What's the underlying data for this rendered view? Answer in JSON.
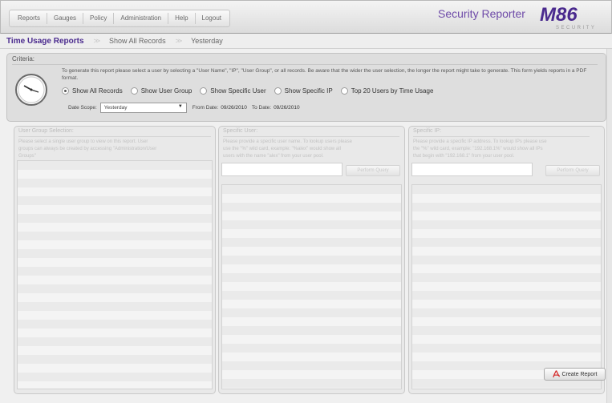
{
  "menu": {
    "items": [
      "Reports",
      "Gauges",
      "Policy",
      "Administration",
      "Help",
      "Logout"
    ]
  },
  "app": {
    "title": "Security Reporter",
    "logo_text": "M86",
    "logo_subtext": "SECURITY"
  },
  "breadcrumb": [
    "Time Usage Reports",
    "Show All Records",
    "Yesterday"
  ],
  "criteria": {
    "title": "Criteria:",
    "description": "To generate this report please select a user by selecting a \"User Name\", \"IP\", \"User Group\", or all records. Be aware that the wider the user selection, the longer the report might take to generate. This form yields reports in a PDF format.",
    "options": [
      "Show All Records",
      "Show User Group",
      "Show Specific User",
      "Show Specific IP",
      "Top 20 Users by Time Usage"
    ],
    "selected_option": "Show All Records",
    "date_scope_label": "Date Scope:",
    "date_scope_value": "Yesterday",
    "from_label": "From Date:",
    "from_value": "09/26/2010",
    "to_label": "To Date:",
    "to_value": "09/26/2010"
  },
  "panels": {
    "group": {
      "title": "User Group Selection:",
      "description_line1": "Please select a single user group to view on this report. User",
      "description_line2": "groups can always be created by accessing \"Administration/User",
      "description_line3": "Groups\""
    },
    "user": {
      "title": "Specific User:",
      "description_line1": "Please provide a specific user name. To lookup users please",
      "description_line2": "use the \"%\" wild card, example: \"%alex\" would show all",
      "description_line3": "users with the name \"alex\" from your user pool.",
      "button_label": "Perform Query"
    },
    "ip": {
      "title": "Specific IP:",
      "description_line1": "Please provide a specific IP address. To lookup IPs please use",
      "description_line2": "the \"%\" wild card, example: \"192.168.1%\" would show all IPs",
      "description_line3": "that begin with \"192.168.1\" from your user pool.",
      "button_label": "Perform Query"
    }
  },
  "actions": {
    "create_report_label": "Create Report"
  },
  "colors": {
    "brand_purple": "#6e4aa8",
    "breadcrumb_active": "#4a2a8e"
  },
  "icons": {
    "clock": "clock-icon",
    "pdf": "pdf-icon",
    "dropdown": "chevron-down-icon"
  }
}
